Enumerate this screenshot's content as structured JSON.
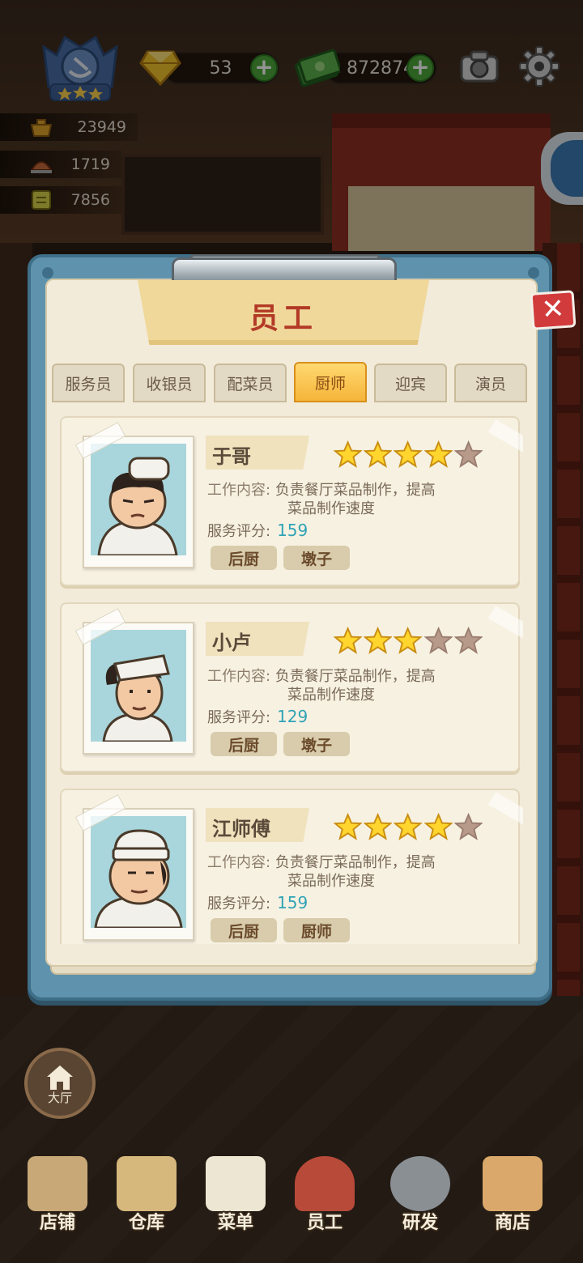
{
  "hud": {
    "gems": "53",
    "cash": "872874",
    "stats": [
      "23949",
      "1719",
      "7856"
    ]
  },
  "modal": {
    "title": "员工",
    "tabs": [
      "服务员",
      "收银员",
      "配菜员",
      "厨师",
      "迎宾",
      "演员"
    ],
    "active_tab": 3,
    "desc_label": "工作内容:",
    "desc_text_1": "负责餐厅菜品制作，提高",
    "desc_text_2": "菜品制作速度",
    "rate_label": "服务评分:",
    "staff": [
      {
        "name": "于哥",
        "stars": 4,
        "score": "159",
        "tags": [
          "后厨",
          "墩子"
        ]
      },
      {
        "name": "小卢",
        "stars": 3,
        "score": "129",
        "tags": [
          "后厨",
          "墩子"
        ]
      },
      {
        "name": "江师傅",
        "stars": 4,
        "score": "159",
        "tags": [
          "后厨",
          "厨师"
        ]
      }
    ]
  },
  "hall_label": "大厅",
  "nav": [
    "店铺",
    "仓库",
    "菜单",
    "员工",
    "研发",
    "商店"
  ],
  "colors": {
    "accent": "#f5b53a",
    "title": "#b23a26",
    "score": "#2fa3b5",
    "frame": "#5f93ad"
  }
}
